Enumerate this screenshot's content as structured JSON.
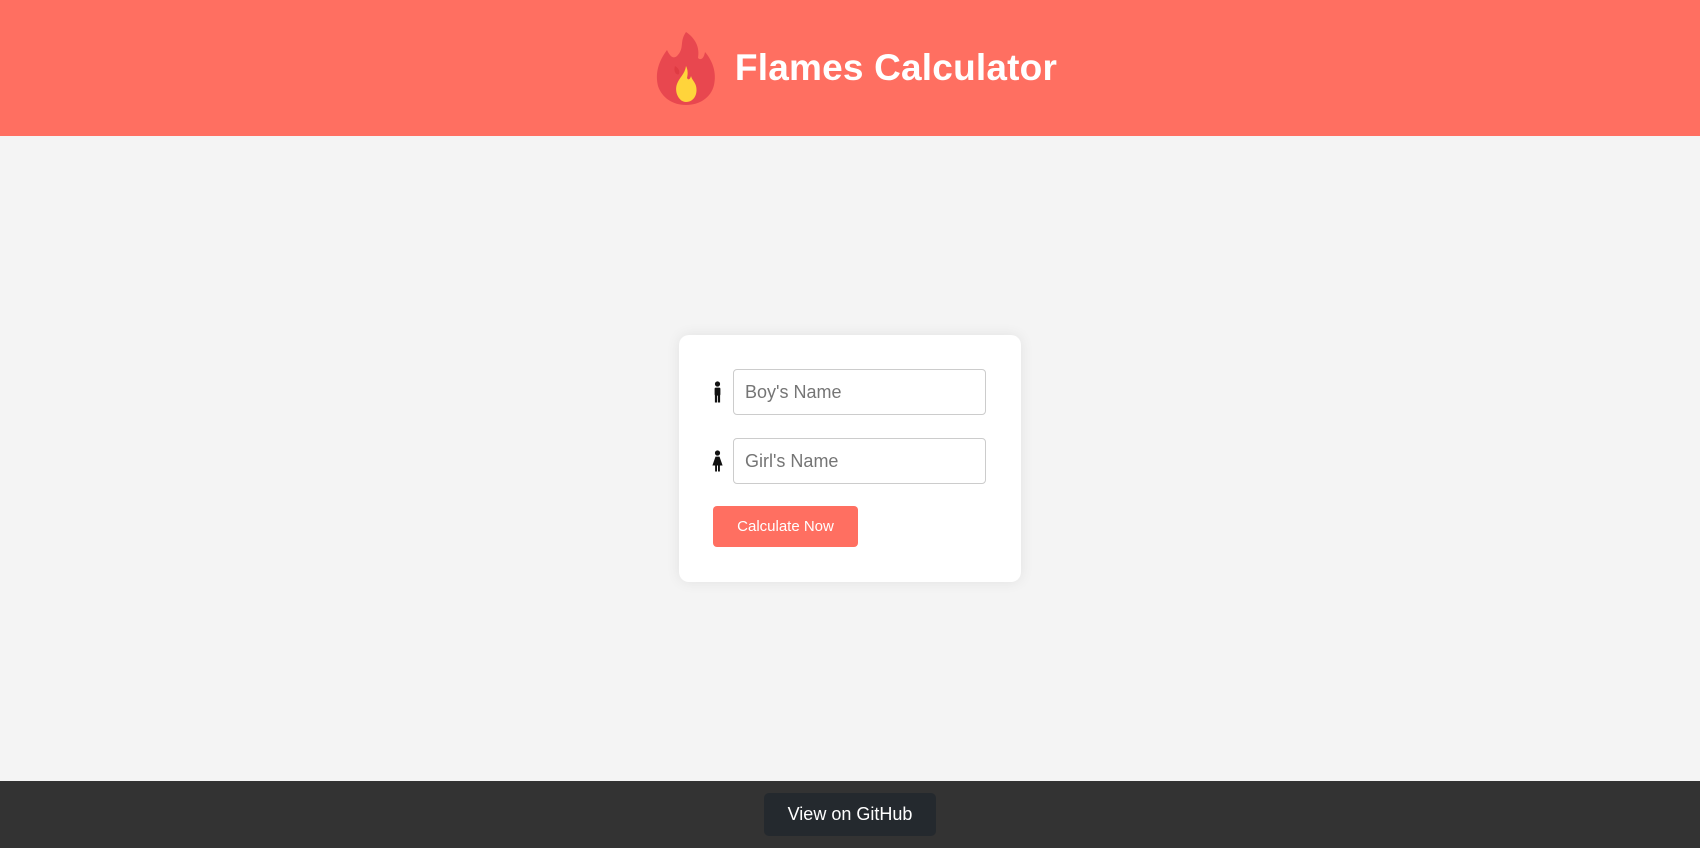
{
  "header": {
    "title": "Flames Calculator",
    "icon": "fire-icon",
    "background_color": "#ff6f61"
  },
  "form": {
    "boy_icon": "man-icon",
    "girl_icon": "woman-icon",
    "boy_input": {
      "placeholder": "Boy's Name",
      "value": ""
    },
    "girl_input": {
      "placeholder": "Girl's Name",
      "value": ""
    },
    "submit_label": "Calculate Now",
    "accent_color": "#ff6f61"
  },
  "footer": {
    "github_label": "View on GitHub",
    "background_color": "#333333",
    "button_color": "#24292e"
  }
}
